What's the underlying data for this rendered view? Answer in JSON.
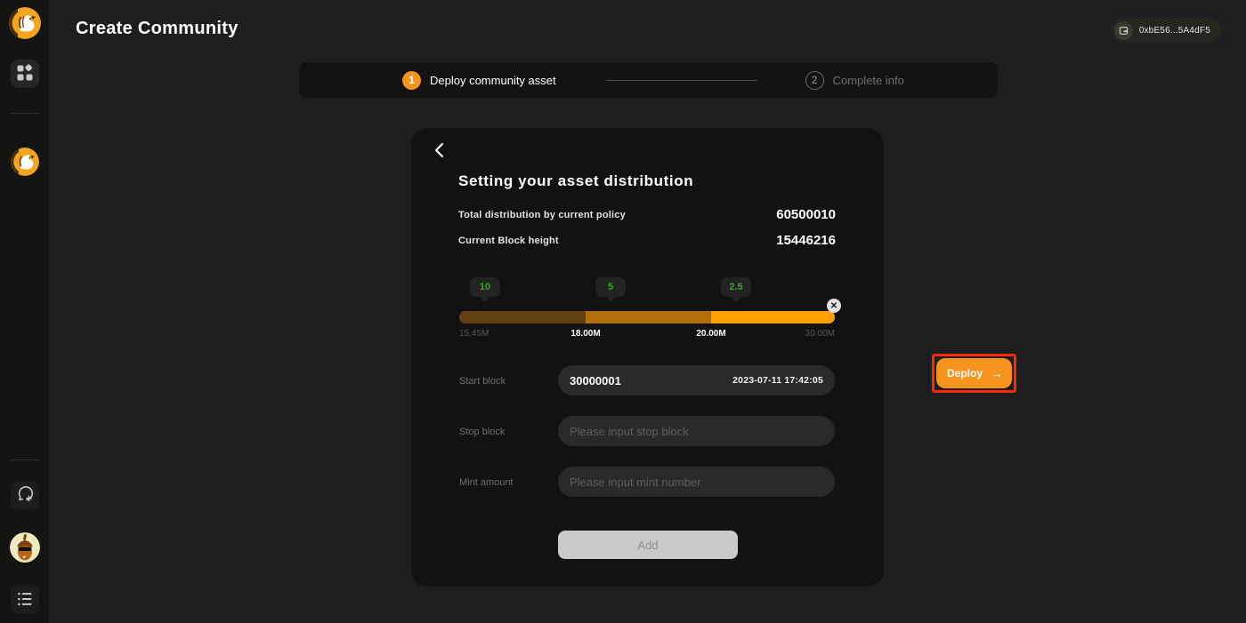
{
  "app": {
    "title": "Create Community"
  },
  "header": {
    "wallet_address": "0xbE56...5A4dF5"
  },
  "sidebar": {
    "icons": [
      "squirrel-logo",
      "dashboard-grid",
      "squirrel-community-avatar",
      "chat-add",
      "acorn-user-avatar",
      "list-menu"
    ]
  },
  "stepper": {
    "steps": [
      {
        "number": "1",
        "label": "Deploy community asset",
        "state": "active"
      },
      {
        "number": "2",
        "label": "Complete info",
        "state": "pending"
      }
    ]
  },
  "card": {
    "heading": "Setting your asset distribution",
    "stats": [
      {
        "label": "Total distribution by current policy",
        "value": "60500010"
      },
      {
        "label": "Current Block height",
        "value": "15446216"
      }
    ],
    "slider": {
      "tooltips": [
        "10",
        "5",
        "2.5"
      ],
      "axis_labels": [
        "15.45M",
        "18.00M",
        "20.00M",
        "30.00M"
      ],
      "segments": [
        {
          "from": "15.45M",
          "to": "18.00M",
          "rate": "10",
          "color": "#63400F"
        },
        {
          "from": "18.00M",
          "to": "20.00M",
          "rate": "5",
          "color": "#B26F0C"
        },
        {
          "from": "20.00M",
          "to": "30.00M",
          "rate": "2.5",
          "color": "#FFA000"
        }
      ],
      "close_glyph": "✕"
    },
    "form": {
      "fields": [
        {
          "label": "Start block",
          "value": "30000001",
          "suffix": "2023-07-11 17:42:05"
        },
        {
          "label": "Stop block",
          "placeholder": "Please input stop block"
        },
        {
          "label": "Mint amount",
          "placeholder": "Please input mint number"
        }
      ],
      "add_label": "Add"
    }
  },
  "deploy": {
    "label": "Deploy",
    "arrow": "→"
  },
  "colors": {
    "accent_orange": "#F7941D",
    "annotation_red": "#FF2B00",
    "tooltip_green": "#3DA32D",
    "page_bg": "#1D1E1F",
    "card_bg": "#121212",
    "sidebar_bg": "#141413"
  }
}
